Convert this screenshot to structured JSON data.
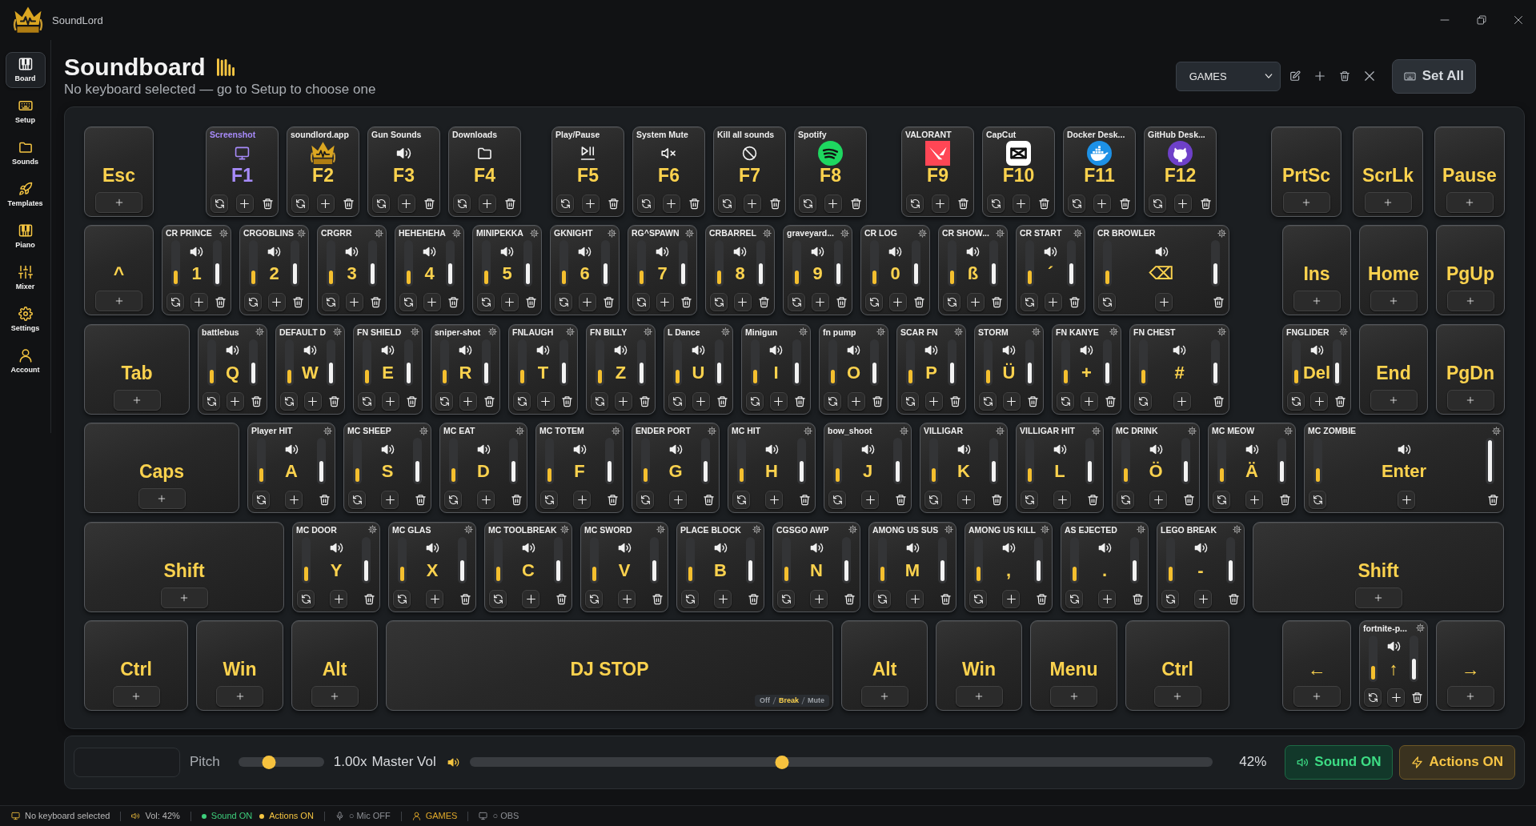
{
  "titlebar": {
    "app_name": "SoundLord"
  },
  "sidebar": {
    "items": [
      {
        "label": "Board",
        "selected": true
      },
      {
        "label": "Setup",
        "selected": false
      },
      {
        "label": "Sounds",
        "selected": false
      },
      {
        "label": "Templates",
        "selected": false
      },
      {
        "label": "Piano",
        "selected": false
      },
      {
        "label": "Mixer",
        "selected": false
      },
      {
        "label": "Settings",
        "selected": false
      },
      {
        "label": "Account",
        "selected": false
      }
    ]
  },
  "header": {
    "title": "Soundboard",
    "subtitle": "No keyboard selected — go to Setup to choose one",
    "profile_select": {
      "value": "GAMES"
    },
    "set_all_button": "Set All"
  },
  "keyboard": {
    "rows": [
      {
        "keys": [
          {
            "kind": "empty",
            "label": "Esc"
          },
          {
            "kind": "action",
            "label": "F1",
            "title": "Screenshot",
            "color": "#a78bfa"
          },
          {
            "kind": "action",
            "label": "F2",
            "title": "soundlord.app"
          },
          {
            "kind": "action",
            "label": "F3",
            "title": "Gun Sounds"
          },
          {
            "kind": "action",
            "label": "F4",
            "title": "Downloads"
          },
          {
            "kind": "action",
            "label": "F5",
            "title": "Play/Pause"
          },
          {
            "kind": "action",
            "label": "F6",
            "title": "System Mute"
          },
          {
            "kind": "action",
            "label": "F7",
            "title": "Kill all sounds"
          },
          {
            "kind": "action",
            "label": "F8",
            "title": "Spotify"
          },
          {
            "kind": "action",
            "label": "F9",
            "title": "VALORANT"
          },
          {
            "kind": "action",
            "label": "F10",
            "title": "CapCut"
          },
          {
            "kind": "action",
            "label": "F11",
            "title": "Docker Desk..."
          },
          {
            "kind": "action",
            "label": "F12",
            "title": "GitHub Desk..."
          },
          {
            "kind": "empty",
            "label": "PrtSc"
          },
          {
            "kind": "empty",
            "label": "ScrLk"
          },
          {
            "kind": "empty",
            "label": "Pause"
          }
        ]
      },
      {
        "keys": [
          {
            "kind": "empty",
            "label": "^"
          },
          {
            "kind": "sound",
            "label": "1",
            "title": "CR PRINCE",
            "sliders": [
              {
                "level": 0.33
              },
              {
                "level": 0.5
              }
            ]
          },
          {
            "kind": "sound",
            "label": "2",
            "title": "CRGOBLINS",
            "sliders": [
              {
                "level": 0.33
              },
              {
                "level": 0.5
              }
            ]
          },
          {
            "kind": "sound",
            "label": "3",
            "title": "CRGRR",
            "sliders": [
              {
                "level": 0.33
              },
              {
                "level": 0.5
              }
            ]
          },
          {
            "kind": "sound",
            "label": "4",
            "title": "HEHEHEHA",
            "sliders": [
              {
                "level": 0.33
              },
              {
                "level": 0.5
              }
            ]
          },
          {
            "kind": "sound",
            "label": "5",
            "title": "MINIPEKKA",
            "sliders": [
              {
                "level": 0.33
              },
              {
                "level": 0.5
              }
            ]
          },
          {
            "kind": "sound",
            "label": "6",
            "title": "GKNIGHT",
            "sliders": [
              {
                "level": 0.33
              },
              {
                "level": 0.5
              }
            ]
          },
          {
            "kind": "sound",
            "label": "7",
            "title": "RG^SPAWN",
            "sliders": [
              {
                "level": 0.33
              },
              {
                "level": 0.5
              }
            ]
          },
          {
            "kind": "sound",
            "label": "8",
            "title": "CRBARREL",
            "sliders": [
              {
                "level": 0.33
              },
              {
                "level": 0.5
              }
            ]
          },
          {
            "kind": "sound",
            "label": "9",
            "title": "graveyard...",
            "sliders": [
              {
                "level": 0.33
              },
              {
                "level": 0.5
              }
            ]
          },
          {
            "kind": "sound",
            "label": "0",
            "title": "CR LOG",
            "sliders": [
              {
                "level": 0.33
              },
              {
                "level": 0.5
              }
            ]
          },
          {
            "kind": "sound",
            "label": "ß",
            "title": "CR SHOW...",
            "sliders": [
              {
                "level": 0.33
              },
              {
                "level": 0.5
              }
            ]
          },
          {
            "kind": "sound",
            "label": "´",
            "title": "CR START",
            "sliders": [
              {
                "level": 0.33
              },
              {
                "level": 0.5
              }
            ]
          },
          {
            "kind": "sound",
            "label": "⌫",
            "title": "CR BROWLER",
            "sliders": [
              {
                "level": 0.33
              },
              {
                "level": 0.5
              }
            ]
          },
          {
            "kind": "empty",
            "label": "Ins"
          },
          {
            "kind": "empty",
            "label": "Home"
          },
          {
            "kind": "empty",
            "label": "PgUp"
          }
        ]
      },
      {
        "keys": [
          {
            "kind": "empty",
            "label": "Tab"
          },
          {
            "kind": "sound",
            "label": "Q",
            "title": "battlebus",
            "sliders": [
              {
                "level": 0.33
              },
              {
                "level": 0.5
              }
            ]
          },
          {
            "kind": "sound",
            "label": "W",
            "title": "DEFAULT D",
            "sliders": [
              {
                "level": 0.33
              },
              {
                "level": 0.5
              }
            ]
          },
          {
            "kind": "sound",
            "label": "E",
            "title": "FN SHIELD",
            "sliders": [
              {
                "level": 0.33
              },
              {
                "level": 0.5
              }
            ]
          },
          {
            "kind": "sound",
            "label": "R",
            "title": "sniper-shot",
            "sliders": [
              {
                "level": 0.33
              },
              {
                "level": 0.5
              }
            ]
          },
          {
            "kind": "sound",
            "label": "T",
            "title": "FNLAUGH",
            "sliders": [
              {
                "level": 0.33
              },
              {
                "level": 0.5
              }
            ]
          },
          {
            "kind": "sound",
            "label": "Z",
            "title": "FN BILLY",
            "sliders": [
              {
                "level": 0.33
              },
              {
                "level": 0.5
              }
            ]
          },
          {
            "kind": "sound",
            "label": "U",
            "title": "L Dance",
            "sliders": [
              {
                "level": 0.33
              },
              {
                "level": 0.5
              }
            ]
          },
          {
            "kind": "sound",
            "label": "I",
            "title": "Minigun",
            "sliders": [
              {
                "level": 0.33
              },
              {
                "level": 0.5
              }
            ]
          },
          {
            "kind": "sound",
            "label": "O",
            "title": "fn pump",
            "sliders": [
              {
                "level": 0.33
              },
              {
                "level": 0.5
              }
            ]
          },
          {
            "kind": "sound",
            "label": "P",
            "title": "SCAR FN",
            "sliders": [
              {
                "level": 0.33
              },
              {
                "level": 0.5
              }
            ]
          },
          {
            "kind": "sound",
            "label": "Ü",
            "title": "STORM",
            "sliders": [
              {
                "level": 0.33
              },
              {
                "level": 0.5
              }
            ]
          },
          {
            "kind": "sound",
            "label": "+",
            "title": "FN KANYE",
            "sliders": [
              {
                "level": 0.33
              },
              {
                "level": 0.5
              }
            ]
          },
          {
            "kind": "sound",
            "label": "#",
            "title": "FN CHEST",
            "sliders": [
              {
                "level": 0.33
              },
              {
                "level": 0.5
              }
            ]
          },
          {
            "kind": "sound",
            "label": "Del",
            "title": "FNGLIDER",
            "sliders": [
              {
                "level": 0.33
              },
              {
                "level": 0.5
              }
            ]
          },
          {
            "kind": "empty",
            "label": "End"
          },
          {
            "kind": "empty",
            "label": "PgDn"
          }
        ]
      },
      {
        "keys": [
          {
            "kind": "empty",
            "label": "Caps"
          },
          {
            "kind": "sound",
            "label": "A",
            "title": "Player HIT",
            "sliders": [
              {
                "level": 0.33
              },
              {
                "level": 0.5
              }
            ]
          },
          {
            "kind": "sound",
            "label": "S",
            "title": "MC SHEEP",
            "sliders": [
              {
                "level": 0.33
              },
              {
                "level": 0.5
              }
            ]
          },
          {
            "kind": "sound",
            "label": "D",
            "title": "MC EAT",
            "sliders": [
              {
                "level": 0.33
              },
              {
                "level": 0.5
              }
            ]
          },
          {
            "kind": "sound",
            "label": "F",
            "title": "MC TOTEM",
            "sliders": [
              {
                "level": 0.33
              },
              {
                "level": 0.5
              }
            ]
          },
          {
            "kind": "sound",
            "label": "G",
            "title": "ENDER PORT",
            "sliders": [
              {
                "level": 0.33
              },
              {
                "level": 0.5
              }
            ]
          },
          {
            "kind": "sound",
            "label": "H",
            "title": "MC HIT",
            "sliders": [
              {
                "level": 0.33
              },
              {
                "level": 0.5
              }
            ]
          },
          {
            "kind": "sound",
            "label": "J",
            "title": "bow_shoot",
            "sliders": [
              {
                "level": 0.33
              },
              {
                "level": 0.5
              }
            ]
          },
          {
            "kind": "sound",
            "label": "K",
            "title": "VILLIGAR",
            "sliders": [
              {
                "level": 0.33
              },
              {
                "level": 0.5
              }
            ]
          },
          {
            "kind": "sound",
            "label": "L",
            "title": "VILLIGAR HIT",
            "sliders": [
              {
                "level": 0.33
              },
              {
                "level": 0.5
              }
            ]
          },
          {
            "kind": "sound",
            "label": "Ö",
            "title": "MC DRINK",
            "sliders": [
              {
                "level": 0.33
              },
              {
                "level": 0.5
              }
            ]
          },
          {
            "kind": "sound",
            "label": "Ä",
            "title": "MC MEOW",
            "sliders": [
              {
                "level": 0.33
              },
              {
                "level": 0.5
              }
            ]
          },
          {
            "kind": "sound",
            "label": "Enter",
            "title": "MC ZOMBIE",
            "sliders": [
              {
                "level": 0.33
              },
              {
                "level": 1
              }
            ]
          }
        ]
      },
      {
        "keys": [
          {
            "kind": "empty",
            "label": "Shift"
          },
          {
            "kind": "sound",
            "label": "Y",
            "title": "MC DOOR",
            "sliders": [
              {
                "level": 0.33
              },
              {
                "level": 0.5
              }
            ]
          },
          {
            "kind": "sound",
            "label": "X",
            "title": "MC GLAS",
            "sliders": [
              {
                "level": 0.33
              },
              {
                "level": 0.5
              }
            ]
          },
          {
            "kind": "sound",
            "label": "C",
            "title": "MC TOOLBREAK",
            "sliders": [
              {
                "level": 0.33
              },
              {
                "level": 0.5
              }
            ]
          },
          {
            "kind": "sound",
            "label": "V",
            "title": "MC SWORD",
            "sliders": [
              {
                "level": 0.33
              },
              {
                "level": 0.5
              }
            ]
          },
          {
            "kind": "sound",
            "label": "B",
            "title": "PLACE BLOCK",
            "sliders": [
              {
                "level": 0.33
              },
              {
                "level": 0.5
              }
            ]
          },
          {
            "kind": "sound",
            "label": "N",
            "title": "CGSGO AWP",
            "sliders": [
              {
                "level": 0.33
              },
              {
                "level": 0.5
              }
            ]
          },
          {
            "kind": "sound",
            "label": "M",
            "title": "AMONG US SUS",
            "sliders": [
              {
                "level": 0.33
              },
              {
                "level": 0.5
              }
            ]
          },
          {
            "kind": "sound",
            "label": ",",
            "title": "AMONG US KILL",
            "sliders": [
              {
                "level": 0.33
              },
              {
                "level": 0.5
              }
            ]
          },
          {
            "kind": "sound",
            "label": ".",
            "title": "AS EJECTED",
            "sliders": [
              {
                "level": 0.33
              },
              {
                "level": 0.5
              }
            ]
          },
          {
            "kind": "sound",
            "label": "-",
            "title": "LEGO BREAK",
            "sliders": [
              {
                "level": 0.33
              },
              {
                "level": 0.5
              }
            ]
          },
          {
            "kind": "empty",
            "label": "Shift"
          }
        ]
      },
      {
        "keys": [
          {
            "kind": "empty",
            "label": "Ctrl"
          },
          {
            "kind": "empty",
            "label": "Win"
          },
          {
            "kind": "empty",
            "label": "Alt"
          },
          {
            "kind": "space",
            "label": "DJ STOP",
            "modes": [
              {
                "label": "Off",
                "selected": false
              },
              {
                "label": "Break",
                "selected": true
              },
              {
                "label": "Mute",
                "selected": false
              }
            ]
          },
          {
            "kind": "empty",
            "label": "Alt"
          },
          {
            "kind": "empty",
            "label": "Win"
          },
          {
            "kind": "empty",
            "label": "Menu"
          },
          {
            "kind": "empty",
            "label": "Ctrl"
          },
          {
            "kind": "empty",
            "label": "←"
          },
          {
            "kind": "sound",
            "label": "↑",
            "title": "fortnite-p...",
            "sliders": [
              {
                "level": 0.33
              },
              {
                "level": 0.5
              }
            ]
          },
          {
            "kind": "empty",
            "label": "→"
          }
        ]
      }
    ]
  },
  "bottom_bar": {
    "pitch_label": "Pitch",
    "pitch_slider": {
      "level": 0.36
    },
    "pitch_value": "1.00x",
    "master_volume_label": "Master Vol",
    "master_volume_slider": {
      "level": 0.42
    },
    "master_volume_value": "42%",
    "sound_button": {
      "label": "Sound ON",
      "on": true
    },
    "actions_button": {
      "label": "Actions ON",
      "on": true
    }
  },
  "status_bar": {
    "groups": [
      {
        "items": [
          {
            "kind": "keyboard",
            "text": "No keyboard selected",
            "color": "#b8b8b8"
          }
        ]
      },
      {
        "items": [
          {
            "kind": "volume",
            "text": "Vol: 42%",
            "color": "#b8b8b8"
          }
        ]
      },
      {
        "items": [
          {
            "kind": "dot",
            "text": "Sound ON",
            "color": "#3ecf7c"
          },
          {
            "kind": "dot",
            "text": "Actions ON",
            "color": "#f5c542"
          }
        ]
      },
      {
        "items": [
          {
            "kind": "mic",
            "text": "○ Mic OFF",
            "color": "#8e9196"
          }
        ]
      },
      {
        "items": [
          {
            "kind": "user",
            "text": "GAMES",
            "color": "#e0a92a"
          }
        ]
      },
      {
        "items": [
          {
            "kind": "monitor",
            "text": "○ OBS",
            "color": "#8e9196"
          }
        ]
      }
    ]
  }
}
